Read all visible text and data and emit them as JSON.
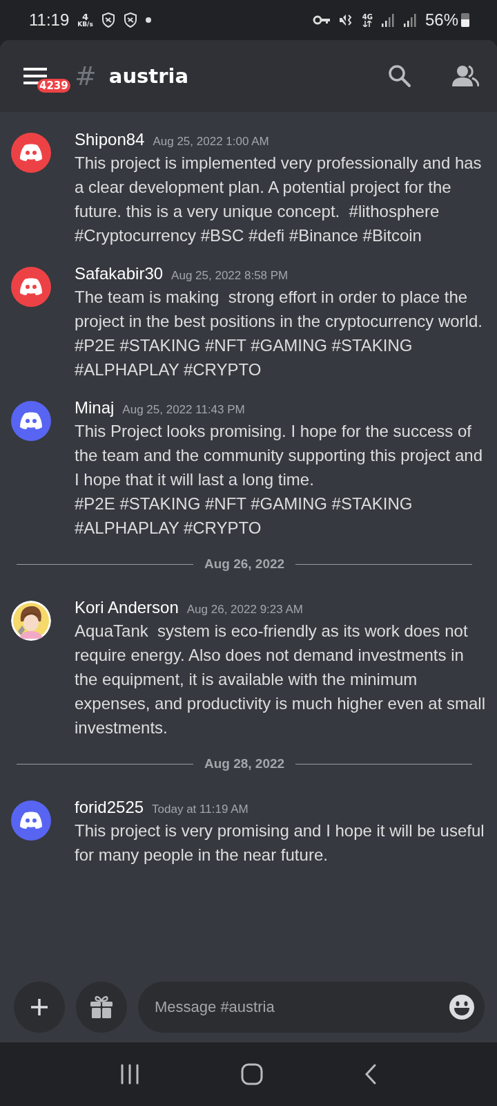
{
  "status_bar": {
    "time": "11:19",
    "speed_value": "4",
    "speed_unit": "KB/s",
    "network": "4G",
    "battery": "56%"
  },
  "header": {
    "unread_badge": "4239",
    "channel_hash": "#",
    "channel": "austria"
  },
  "feed": [
    {
      "kind": "message",
      "author": "Shipon84",
      "avatar": {
        "kind": "logo",
        "color": "#ed4245"
      },
      "time": "Aug 25, 2022 1:00 AM",
      "text": "This project is implemented very professionally and has a clear development plan. A potential project for the future. this is a very unique concept.  #lithosphere #Cryptocurrency #BSC #defi #Binance #Bitcoin"
    },
    {
      "kind": "message",
      "author": "Safakabir30",
      "avatar": {
        "kind": "logo",
        "color": "#ed4245"
      },
      "time": "Aug 25, 2022 8:58 PM",
      "text": "The team is making  strong effort in order to place the project in the best positions in the cryptocurrency world.\n#P2E #STAKING #NFT #GAMING #STAKING #ALPHAPLAY #CRYPTO"
    },
    {
      "kind": "message",
      "author": "Minaj",
      "avatar": {
        "kind": "logo",
        "color": "#5865f2"
      },
      "time": "Aug 25, 2022 11:43 PM",
      "text": "This Project looks promising. I hope for the success of the team and the community supporting this project and I hope that it will last a long time.\n#P2E #STAKING #NFT #GAMING #STAKING #ALPHAPLAY #CRYPTO"
    },
    {
      "kind": "divider",
      "label": "Aug 26, 2022"
    },
    {
      "kind": "message",
      "author": "Kori Anderson",
      "time": "Aug 26, 2022 9:23 AM",
      "text": "AquaTank  system is eco-friendly as its work does not require energy. Also does not demand investments in the equipment, it is available with the minimum expenses, and productivity is much higher even at small investments."
    },
    {
      "kind": "divider",
      "label": "Aug 28, 2022"
    },
    {
      "kind": "message",
      "author": "forid2525",
      "avatar": {
        "kind": "logo",
        "color": "#5865f2"
      },
      "time": "Today at 11:19 AM",
      "text": "This project is very promising and I hope it will be useful for many people in the near future."
    }
  ],
  "composer": {
    "placeholder": "Message #austria"
  }
}
